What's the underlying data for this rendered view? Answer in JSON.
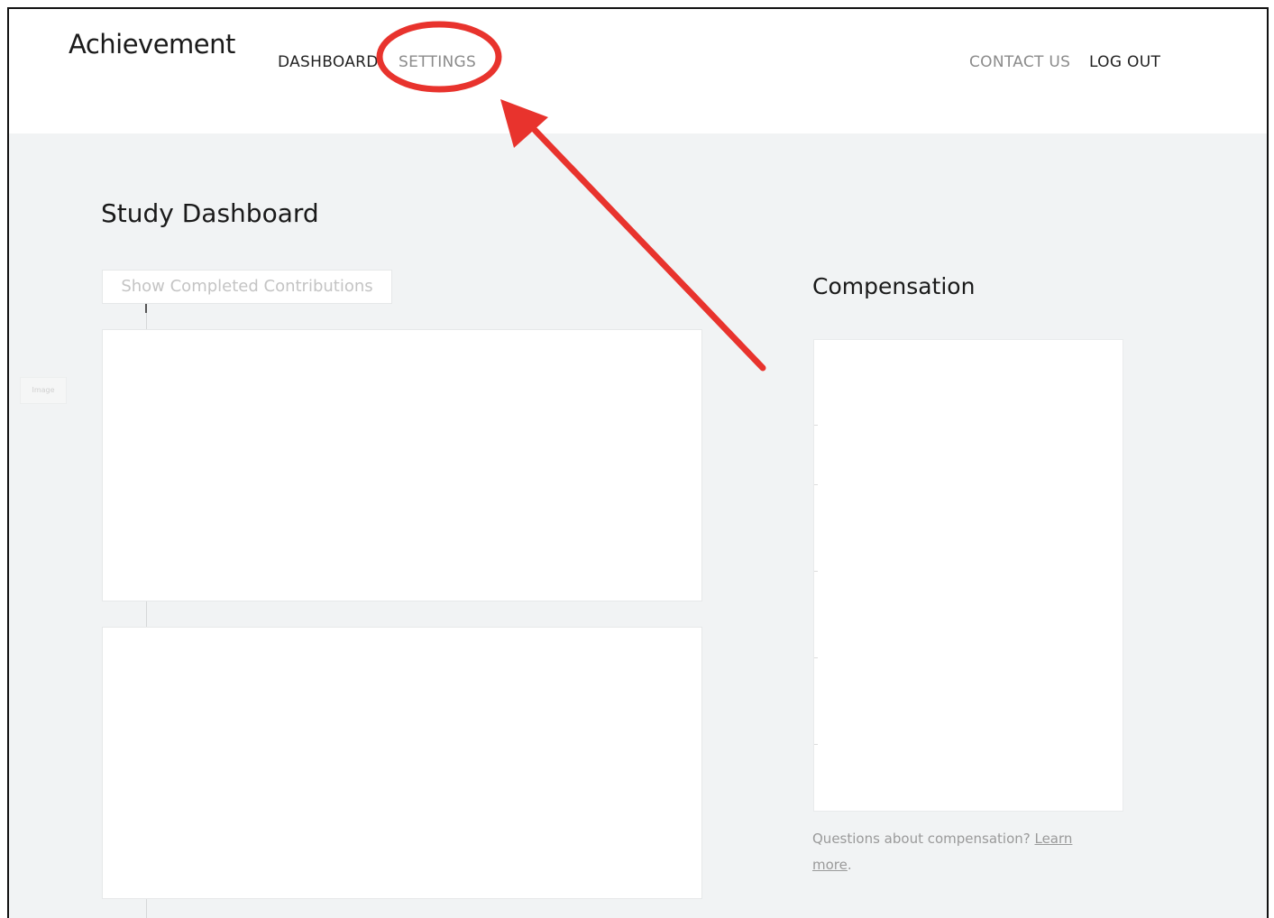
{
  "app": {
    "logo": "Achievement"
  },
  "nav": {
    "dashboard": "DASHBOARD",
    "settings": "SETTINGS",
    "contact": "CONTACT US",
    "logout": "LOG OUT"
  },
  "main": {
    "title": "Study Dashboard",
    "toggle_label": "Show Completed Contributions",
    "side_image_label": "Image"
  },
  "compensation": {
    "title": "Compensation",
    "note_text": "Questions about compensation? ",
    "note_link": "Learn more",
    "note_suffix": "."
  },
  "colors": {
    "annotation_red": "#e8332d",
    "background_gray": "#f1f3f4",
    "text_dark": "#1a1a1a",
    "text_muted": "#8b8b8b"
  },
  "icons": {
    "highlight": "red-circle-highlight-icon",
    "pointer": "red-arrow-icon"
  }
}
